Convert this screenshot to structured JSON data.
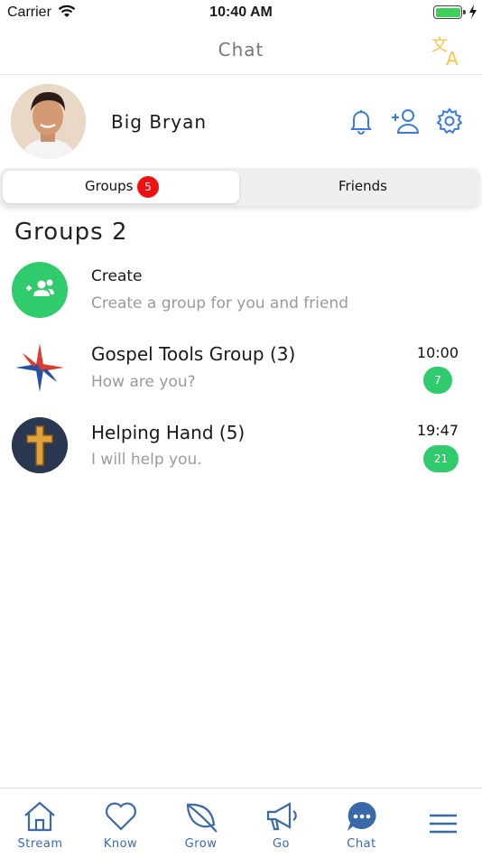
{
  "status": {
    "carrier": "Carrier",
    "time": "10:40 AM"
  },
  "nav": {
    "title": "Chat"
  },
  "profile": {
    "name": "Big Bryan"
  },
  "segments": {
    "groups_label": "Groups",
    "groups_badge": "5",
    "friends_label": "Friends"
  },
  "section_title": "Groups 2",
  "create": {
    "title": "Create",
    "subtitle": "Create a group for you and friend"
  },
  "groups": [
    {
      "title": "Gospel Tools Group (3)",
      "subtitle": "How are you?",
      "time": "10:00",
      "count": "7"
    },
    {
      "title": "Helping Hand (5)",
      "subtitle": "I will help you.",
      "time": "19:47",
      "count": "21"
    }
  ],
  "tabs": [
    {
      "label": "Stream",
      "icon": "home-icon"
    },
    {
      "label": "Know",
      "icon": "heart-icon"
    },
    {
      "label": "Grow",
      "icon": "leaf-icon"
    },
    {
      "label": "Go",
      "icon": "megaphone-icon"
    },
    {
      "label": "Chat",
      "icon": "chat-bubble-icon"
    },
    {
      "label": "",
      "icon": "menu-icon"
    }
  ],
  "colors": {
    "accent": "#3b6aa8",
    "green": "#2fcb6c",
    "badge_red": "#ee1111",
    "translate_yellow": "#f5c74a"
  }
}
